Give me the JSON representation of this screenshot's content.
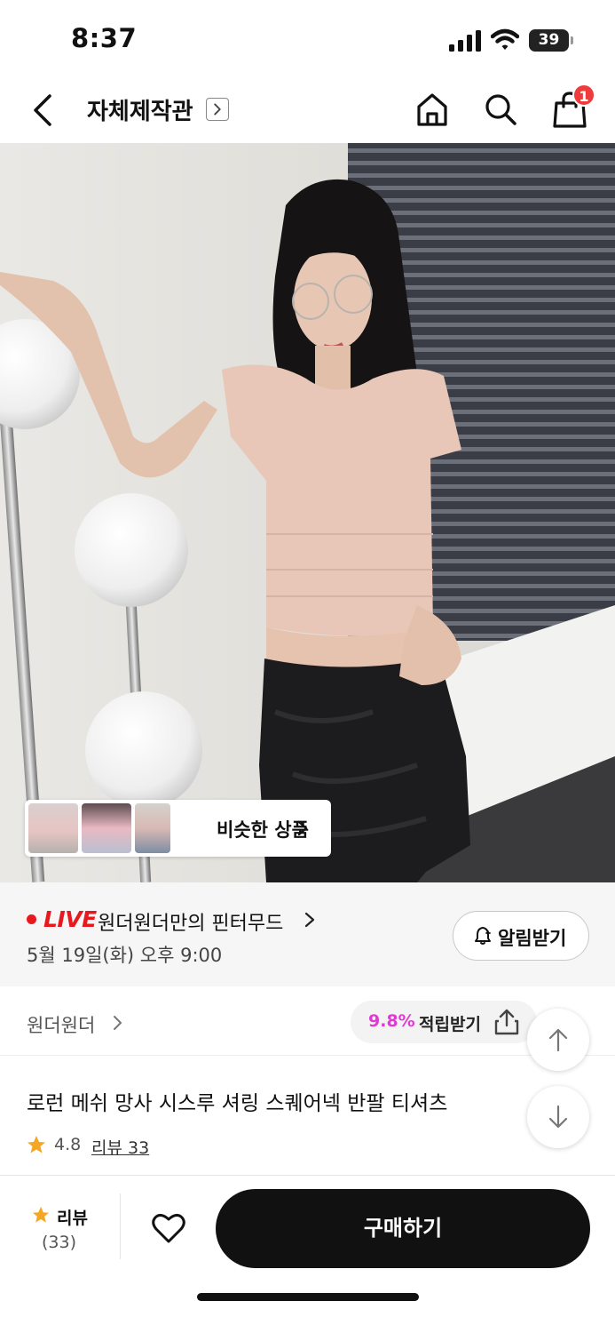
{
  "status_bar": {
    "time": "8:37",
    "battery": "39"
  },
  "header": {
    "title": "자체제작관",
    "cart_badge": "1"
  },
  "hero": {
    "similar_label": "비슷한 상품"
  },
  "live": {
    "badge": "LIVE",
    "show_name": "원더원더만의 핀터무드",
    "date": "5월 19일(화) 오후 9:00",
    "alarm_label": "알림받기"
  },
  "brand": {
    "name": "원더원더",
    "reward_pct": "9.8%",
    "reward_label": "적립받기"
  },
  "product": {
    "title": "로런 메쉬 망사 시스루 셔링 스퀘어넥 반팔 티셔츠",
    "rating": "4.8",
    "reviews_label": "리뷰 33"
  },
  "bottom_bar": {
    "review_label": "리뷰",
    "review_count": "(33)",
    "buy_label": "구매하기"
  },
  "colors": {
    "live_red": "#e8191e",
    "reward_pink": "#e13ad4",
    "star": "#f5a623",
    "badge_red": "#ef3b3b"
  },
  "icons": [
    "back-icon",
    "home-icon",
    "search-icon",
    "cart-icon",
    "bell-icon",
    "share-icon",
    "arrow-up-icon",
    "arrow-down-icon",
    "star-icon",
    "heart-icon"
  ]
}
